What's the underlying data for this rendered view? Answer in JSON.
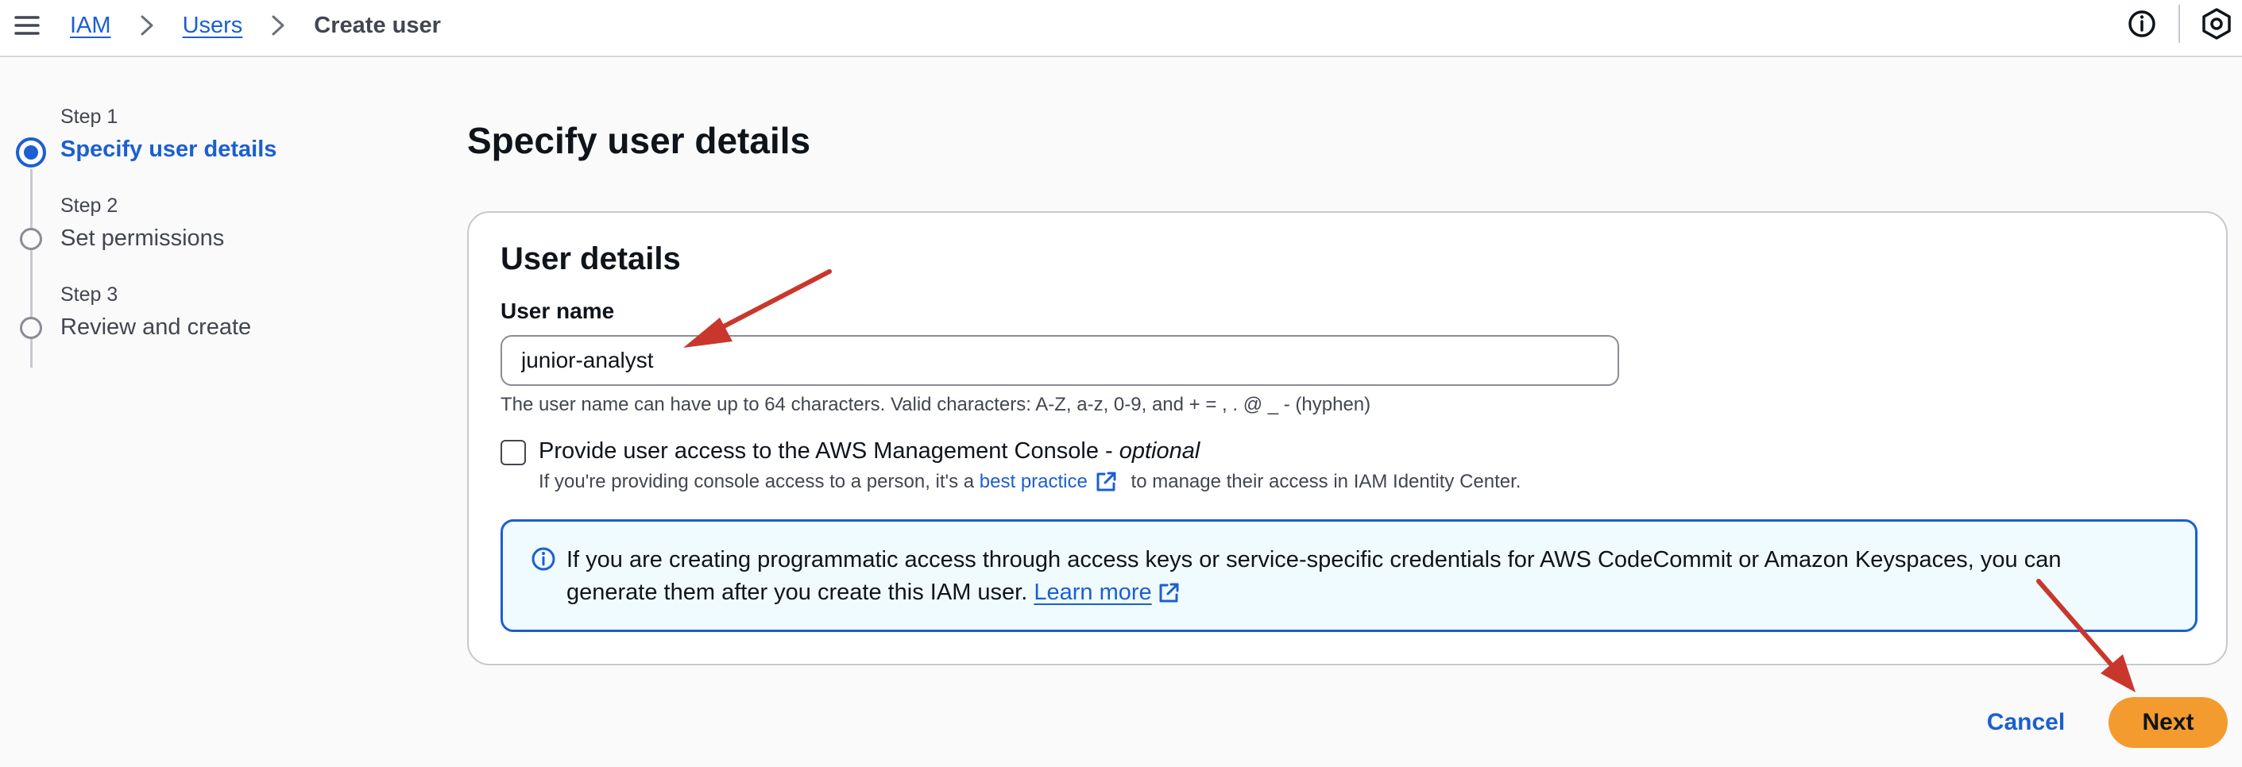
{
  "breadcrumb": {
    "root": "IAM",
    "parent": "Users",
    "current": "Create user"
  },
  "steps": [
    {
      "label": "Step 1",
      "title": "Specify user details",
      "state": "active"
    },
    {
      "label": "Step 2",
      "title": "Set permissions",
      "state": "pending"
    },
    {
      "label": "Step 3",
      "title": "Review and create",
      "state": "pending"
    }
  ],
  "page": {
    "title": "Specify user details"
  },
  "user_details": {
    "title": "User details",
    "username_label": "User name",
    "username_value": "junior-analyst",
    "constraint": "The user name can have up to 64 characters. Valid characters: A-Z, a-z, 0-9, and + = , . @ _ - (hyphen)",
    "console_access": {
      "label": "Provide user access to the AWS Management Console - ",
      "optional": "optional",
      "checked": false,
      "desc_before": "If you're providing console access to a person, it's a ",
      "desc_link": "best practice",
      "desc_after": " to manage their access in IAM Identity Center."
    },
    "alert": {
      "text": "If you are creating programmatic access through access keys or service-specific credentials for AWS CodeCommit or Amazon Keyspaces, you can generate them after you create this IAM user. ",
      "link": "Learn more"
    }
  },
  "actions": {
    "cancel": "Cancel",
    "next": "Next"
  },
  "colors": {
    "accent": "#1b5fd1",
    "primary_button": "#f39b2e",
    "annotation_arrow": "#c9372c",
    "alert_background": "#f0fbff"
  },
  "icons": [
    "menu-icon",
    "chevron-right-icon",
    "info-icon",
    "settings-icon",
    "external-link-icon"
  ]
}
